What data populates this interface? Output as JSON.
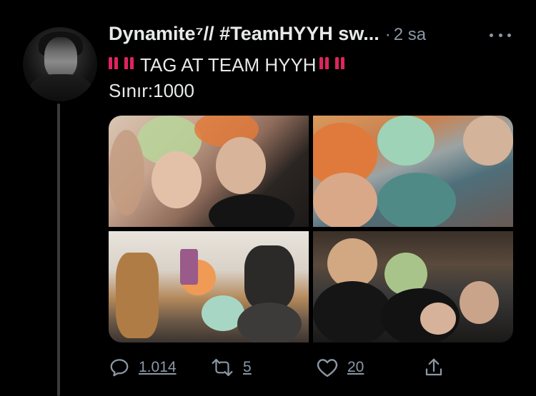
{
  "tweet": {
    "display_name": "Dynamite⁷// #TeamHYYH sw...",
    "separator": "·",
    "timestamp": "2 sa",
    "line1_text": "TAG AT TEAM HYYH",
    "line2_text": "Sınır:1000",
    "emoji_name": "double-exclamation-icon",
    "emoji_color": "#e0245e"
  },
  "media": {
    "photo_count": 4
  },
  "actions": {
    "reply_count": "1.014",
    "retweet_count": "5",
    "like_count": "20"
  },
  "colors": {
    "background": "#000000",
    "text": "#e7e9ea",
    "muted": "#8b98a5",
    "thread_line": "#3a3a3a"
  }
}
